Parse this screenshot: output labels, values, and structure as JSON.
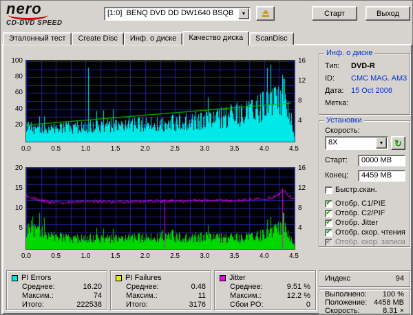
{
  "header": {
    "logo_top": "nero",
    "logo_sub": "CD-DVD SPEED",
    "drive": "[1:0]  BENQ DVD DD DW1640 BSQB",
    "start_button": "Старт",
    "exit_button": "Выход"
  },
  "tabs": [
    {
      "label": "Эталонный тест",
      "active": false
    },
    {
      "label": "Create Disc",
      "active": false
    },
    {
      "label": "Инф. о диске",
      "active": false
    },
    {
      "label": "Качество диска",
      "active": true
    },
    {
      "label": "ScanDisc",
      "active": false
    }
  ],
  "disc_info": {
    "title": "Инф. о диске",
    "rows": [
      {
        "label": "Тип:",
        "value": "DVD-R"
      },
      {
        "label": "ID:",
        "value": "CMC MAG. AM3"
      },
      {
        "label": "Дата:",
        "value": "15 Oct 2006"
      },
      {
        "label": "Метка:",
        "value": ""
      }
    ]
  },
  "settings": {
    "title": "Установки",
    "speed_label": "Скорость:",
    "speed": "8X",
    "start_label": "Старт:",
    "start_value": "0000 MB",
    "end_label": "Конец:",
    "end_value": "4459 MB",
    "fast_scan_label": "Быстр.скан.",
    "checks": [
      {
        "label": "Отобр. C1/PIE",
        "checked": true,
        "disabled": false
      },
      {
        "label": "Отобр. C2/PIF",
        "checked": true,
        "disabled": false
      },
      {
        "label": "Отобр. Jitter",
        "checked": true,
        "disabled": false
      },
      {
        "label": "Отобр. скор. чтения",
        "checked": true,
        "disabled": false
      },
      {
        "label": "Отобр. скор. записи",
        "checked": true,
        "disabled": true
      }
    ]
  },
  "index_panel": {
    "label": "Индекс",
    "value": "94"
  },
  "progress_panel": {
    "rows": [
      {
        "label": "Выполнено:",
        "value": "100 %"
      },
      {
        "label": "Положение:",
        "value": "4458 MB"
      },
      {
        "label": "Скорость:",
        "value": "8.31 ×"
      }
    ]
  },
  "legends": [
    {
      "title": "PI Errors",
      "color": "#00e8e8",
      "rows": [
        {
          "label": "Среднее:",
          "value": "16.20"
        },
        {
          "label": "Максим.:",
          "value": "74"
        },
        {
          "label": "Итого:",
          "value": "222538"
        }
      ]
    },
    {
      "title": "PI Failures",
      "color": "#e8e800",
      "rows": [
        {
          "label": "Среднее:",
          "value": "0.48"
        },
        {
          "label": "Максим.:",
          "value": "11"
        },
        {
          "label": "Итого:",
          "value": "3176"
        }
      ]
    },
    {
      "title": "Jitter",
      "color": "#e800e8",
      "rows": [
        {
          "label": "Среднее:",
          "value": "9.51 %"
        },
        {
          "label": "Максим.:",
          "value": "12.2 %"
        },
        {
          "label": "Сбои PO:",
          "value": "0"
        }
      ]
    }
  ],
  "chart_data": [
    {
      "type": "area",
      "name": "pi-errors-and-read-speed",
      "x_min": 0,
      "x_max": 4.5,
      "x_ticks": [
        "0.0",
        "0.5",
        "1.0",
        "1.5",
        "2.0",
        "2.5",
        "3.0",
        "3.5",
        "4.0",
        "4.5"
      ],
      "y_left": {
        "max": 100,
        "ticks": [
          20,
          40,
          60,
          80,
          100
        ],
        "grid_step": 10
      },
      "y_right": {
        "max": 16,
        "ticks": [
          4,
          8,
          12,
          16
        ]
      },
      "series": [
        {
          "name": "PI Errors",
          "style": "noisefill",
          "color": "#00e8e8",
          "axis": "left",
          "envelope": [
            [
              0,
              25
            ],
            [
              0.2,
              22
            ],
            [
              0.5,
              22
            ],
            [
              0.8,
              25
            ],
            [
              1.2,
              27
            ],
            [
              1.6,
              29
            ],
            [
              2.0,
              31
            ],
            [
              2.4,
              33
            ],
            [
              2.7,
              36
            ],
            [
              3.0,
              38
            ],
            [
              3.2,
              42
            ],
            [
              3.4,
              46
            ],
            [
              3.6,
              51
            ],
            [
              3.8,
              56
            ],
            [
              3.95,
              61
            ],
            [
              4.1,
              68
            ],
            [
              4.2,
              76
            ],
            [
              4.3,
              84
            ],
            [
              4.38,
              74
            ],
            [
              4.45,
              45
            ],
            [
              4.5,
              6
            ]
          ]
        },
        {
          "name": "PI Error spikes",
          "style": "vspikes",
          "color": "#00e8e8",
          "axis": "left",
          "spikes": [
            [
              1.04,
              92
            ],
            [
              4.3,
              83
            ],
            [
              4.34,
              78
            ]
          ]
        },
        {
          "name": "Reading speed",
          "style": "line",
          "color": "#00c400",
          "axis": "right",
          "points": [
            [
              0,
              3.2
            ],
            [
              4.45,
              7.6
            ]
          ]
        }
      ]
    },
    {
      "type": "area",
      "name": "pi-failures-and-jitter",
      "x_min": 0,
      "x_max": 4.5,
      "x_ticks": [
        "0.0",
        "0.5",
        "1.0",
        "1.5",
        "2.0",
        "2.5",
        "3.0",
        "3.5",
        "4.0",
        "4.5"
      ],
      "y_left": {
        "max": 20,
        "ticks": [
          5,
          10,
          15,
          20
        ],
        "grid_step": 2
      },
      "y_right": {
        "max": 16,
        "ticks": [
          4,
          8,
          12,
          16
        ]
      },
      "series": [
        {
          "name": "PI Failures",
          "style": "noisefill",
          "color": "#00d800",
          "axis": "left",
          "envelope": [
            [
              0,
              6
            ],
            [
              0.12,
              7.5
            ],
            [
              0.25,
              6
            ],
            [
              0.4,
              4.5
            ],
            [
              0.7,
              3.5
            ],
            [
              1.0,
              3.8
            ],
            [
              1.4,
              3.5
            ],
            [
              1.8,
              3.8
            ],
            [
              2.2,
              4
            ],
            [
              2.32,
              5.5
            ],
            [
              2.6,
              3.8
            ],
            [
              3.0,
              4.2
            ],
            [
              3.4,
              3.8
            ],
            [
              3.8,
              4.2
            ],
            [
              4.0,
              4.8
            ],
            [
              4.15,
              6
            ],
            [
              4.25,
              8
            ],
            [
              4.33,
              9.5
            ],
            [
              4.4,
              6
            ],
            [
              4.45,
              3.5
            ],
            [
              4.5,
              1
            ]
          ]
        },
        {
          "name": "PI Failure spikes",
          "style": "vspikes",
          "color": "#00d800",
          "axis": "left",
          "spikes": [
            [
              0.1,
              8
            ],
            [
              4.3,
              10.5
            ],
            [
              4.33,
              9
            ]
          ]
        },
        {
          "name": "Jitter",
          "style": "noisyline",
          "color": "#e800e8",
          "axis": "right",
          "noise": 0.35,
          "points": [
            [
              0,
              10.6
            ],
            [
              0.15,
              10.0
            ],
            [
              0.35,
              9.3
            ],
            [
              0.6,
              9.2
            ],
            [
              1.0,
              9.4
            ],
            [
              1.5,
              9.3
            ],
            [
              2.0,
              9.4
            ],
            [
              2.5,
              9.5
            ],
            [
              3.0,
              9.5
            ],
            [
              3.5,
              9.6
            ],
            [
              3.9,
              9.8
            ],
            [
              4.1,
              10.1
            ],
            [
              4.25,
              10.8
            ],
            [
              4.32,
              12.0
            ],
            [
              4.4,
              10.6
            ],
            [
              4.5,
              10.0
            ]
          ]
        },
        {
          "name": "Jitter spikes",
          "style": "vspikes",
          "color": "#e800e8",
          "axis": "right",
          "spikes": [
            [
              2.32,
              9.7
            ],
            [
              4.3,
              12.0
            ]
          ]
        }
      ]
    }
  ]
}
